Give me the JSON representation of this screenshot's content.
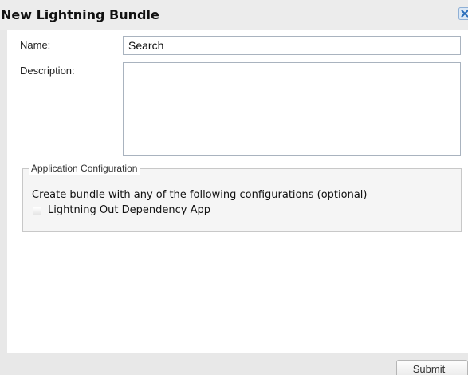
{
  "dialog": {
    "title": "New Lightning Bundle",
    "close_icon": "close-icon"
  },
  "form": {
    "name_label": "Name:",
    "name_value": "Search",
    "description_label": "Description:",
    "description_value": ""
  },
  "app_config": {
    "legend": "Application Configuration",
    "description": "Create bundle with any of the following configurations (optional)",
    "option_label": "Lightning Out Dependency App",
    "option_checked": false
  },
  "footer": {
    "submit_label": "Submit"
  },
  "colors": {
    "chrome_background": "#e8e8e8",
    "content_background": "#ffffff",
    "close_icon_accent": "#2a6ebb"
  }
}
